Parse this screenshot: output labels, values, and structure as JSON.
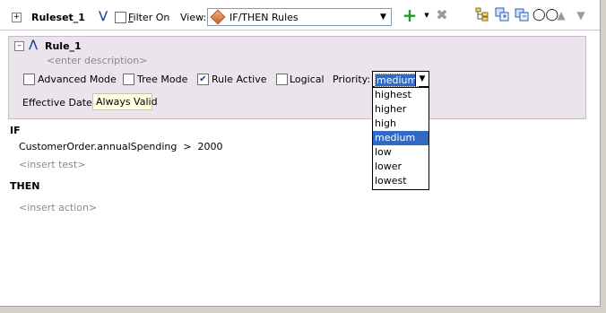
{
  "toolbar": {
    "ruleset_name": "Ruleset_1",
    "filter_label": "Filter On",
    "filter_checked": false,
    "view_label": "View:",
    "view_value": "IF/THEN Rules",
    "icons": [
      "expand-icon",
      "chevron-double-down-icon",
      "add-icon",
      "dropdown-arrow-icon",
      "delete-icon",
      "tree-icon",
      "copy-icon",
      "paste-icon",
      "glasses-icon",
      "move-up-icon",
      "move-down-icon"
    ]
  },
  "rule": {
    "name": "Rule_1",
    "description_placeholder": "<enter description>",
    "options": {
      "advanced_mode": {
        "label": "Advanced Mode",
        "checked": false
      },
      "tree_mode": {
        "label": "Tree Mode",
        "checked": false
      },
      "rule_active": {
        "label": "Rule Active",
        "checked": true
      },
      "logical": {
        "label": "Logical",
        "checked": false
      }
    },
    "priority_label": "Priority:",
    "priority_value": "medium",
    "priority_options": [
      "highest",
      "higher",
      "high",
      "medium",
      "low",
      "lower",
      "lowest"
    ],
    "effective_date_label": "Effective Date:",
    "effective_date_value": "Always Valid"
  },
  "body": {
    "if_label": "IF",
    "condition": "CustomerOrder.annualSpending  >  2000",
    "insert_test": "<insert test>",
    "then_label": "THEN",
    "insert_action": "<insert action>"
  },
  "colors": {
    "rule_bg": "#ece4ec",
    "selection": "#3169c6",
    "effective_date_bg": "#ffffe1"
  }
}
